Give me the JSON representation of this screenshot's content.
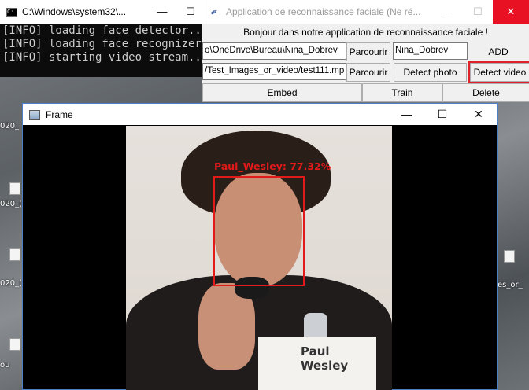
{
  "console": {
    "title": "C:\\Windows\\system32\\...",
    "lines": [
      "[INFO] loading face detector...",
      "[INFO] loading face recognizer...",
      "[INFO] starting video stream..."
    ]
  },
  "app": {
    "title": "Application de reconnaissance faciale (Ne ré...",
    "greeting": "Bonjour dans notre application de reconnaissance faciale !",
    "path_input": "o\\OneDrive\\Bureau\\Nina_Dobrev",
    "browse1": "Parcourir",
    "name_input": "Nina_Dobrev",
    "add": "ADD",
    "video_input": "/Test_Images_or_video/test111.mp",
    "browse2": "Parcourir",
    "detect_photo": "Detect photo",
    "detect_video": "Detect video",
    "embed": "Embed",
    "train": "Train",
    "delete": "Delete"
  },
  "frame": {
    "title": "Frame",
    "face_label": "Paul_Wesley: 77.32%",
    "name_card": "Paul Wesley"
  },
  "desktop": {
    "labels": [
      "020_",
      "020_(",
      "020_(",
      "020_(",
      "es_or_",
      "ou"
    ]
  }
}
